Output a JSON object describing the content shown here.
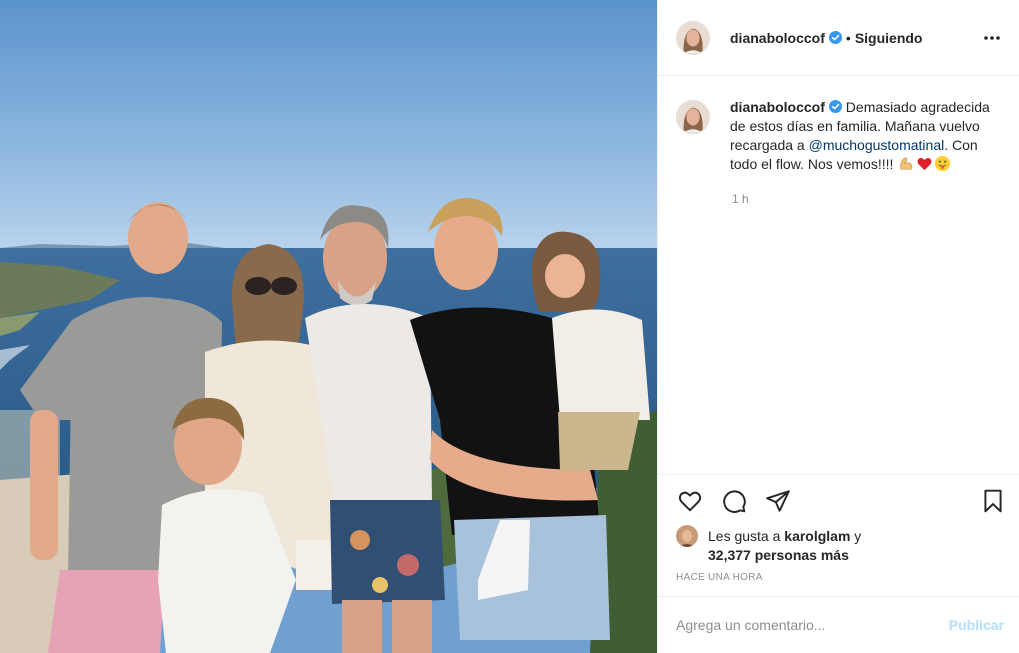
{
  "post": {
    "username": "dianaboloccof",
    "separator": "•",
    "follow_status": "Siguiendo",
    "more_icon": "more-horizontal-icon",
    "photo_alt": "family-photo"
  },
  "caption": {
    "username": "dianaboloccof",
    "text_before": "Demasiado agradecida de estos días en familia. Mañana vuelvo recargada a ",
    "mention": "@muchogustomatinal",
    "text_after": ". Con todo el flow. Nos vemos!!!! ",
    "emojis": [
      "flexed-biceps-emoji",
      "red-heart-emoji",
      "tongue-face-emoji"
    ],
    "time": "1 h"
  },
  "actions": {
    "like_icon": "heart-icon",
    "comment_icon": "comment-icon",
    "share_icon": "send-icon",
    "save_icon": "bookmark-icon"
  },
  "likes": {
    "prefix": "Les gusta a ",
    "user": "karolglam",
    "joiner": " y",
    "count": "32,377 personas más"
  },
  "timestamp": "HACE UNA HORA",
  "comment_form": {
    "placeholder": "Agrega un comentario...",
    "publish_label": "Publicar"
  },
  "colors": {
    "text": "#262626",
    "muted": "#8e8e8e",
    "mention": "#00376b",
    "verified": "#3897f0",
    "publish_disabled": "#b2dffc",
    "divider": "#efefef"
  }
}
